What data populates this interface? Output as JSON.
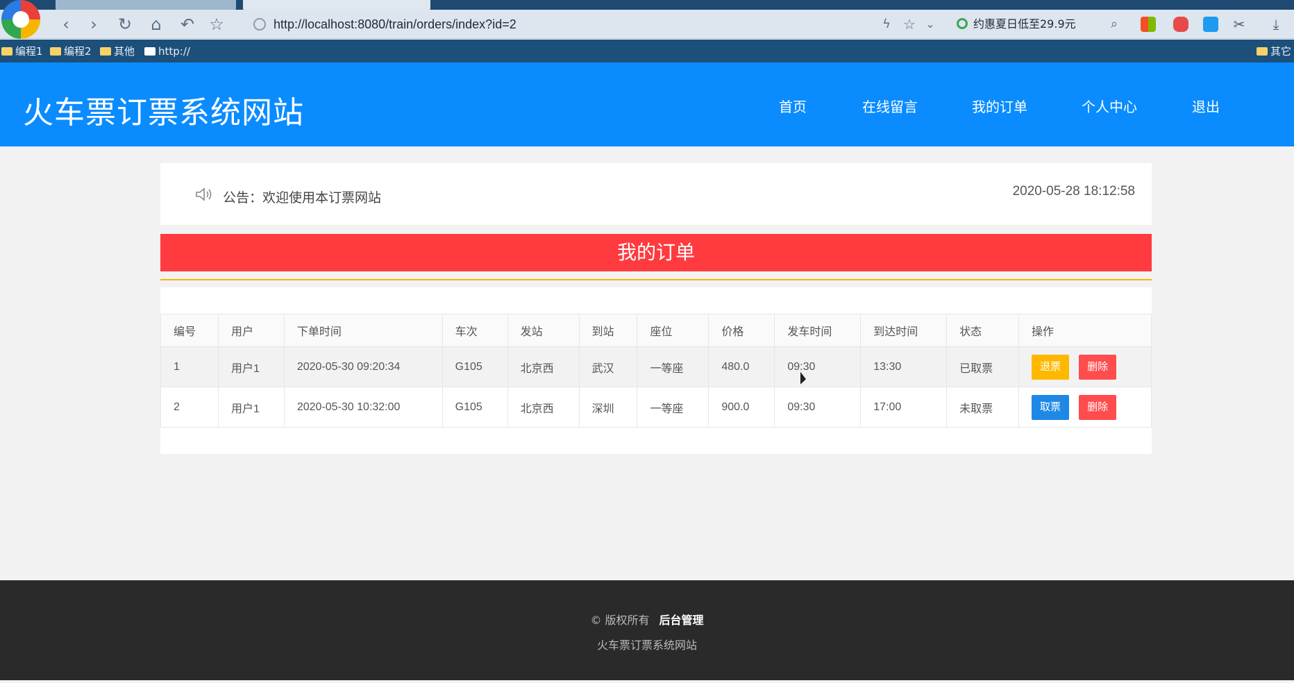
{
  "browser": {
    "url": "http://localhost:8080/train/orders/index?id=2",
    "promo": "约惠夏日低至29.9元",
    "bookmarks": [
      "编程1",
      "编程2",
      "其他",
      "http://"
    ],
    "bookmark_right": "其它"
  },
  "header": {
    "title": "火车票订票系统网站",
    "nav": [
      "首页",
      "在线留言",
      "我的订单",
      "个人中心",
      "退出"
    ]
  },
  "notice": {
    "text": "公告：欢迎使用本订票网站",
    "datetime": "2020-05-28 18:12:58"
  },
  "orders": {
    "title": "我的订单",
    "columns": [
      "编号",
      "用户",
      "下单时间",
      "车次",
      "发站",
      "到站",
      "座位",
      "价格",
      "发车时间",
      "到达时间",
      "状态",
      "操作"
    ],
    "rows": [
      {
        "id": "1",
        "user": "用户1",
        "order_time": "2020-05-30 09:20:34",
        "train": "G105",
        "from": "北京西",
        "to": "武汉",
        "seat": "一等座",
        "price": "480.0",
        "depart": "09:30",
        "arrive": "13:30",
        "status": "已取票",
        "action1": "退票",
        "action2": "删除"
      },
      {
        "id": "2",
        "user": "用户1",
        "order_time": "2020-05-30 10:32:00",
        "train": "G105",
        "from": "北京西",
        "to": "深圳",
        "seat": "一等座",
        "price": "900.0",
        "depart": "09:30",
        "arrive": "17:00",
        "status": "未取票",
        "action1": "取票",
        "action2": "删除"
      }
    ]
  },
  "footer": {
    "copyright": "© 版权所有",
    "admin_link": "后台管理",
    "site_name": "火车票订票系统网站"
  },
  "colors": {
    "header_bg": "#0a8cff",
    "banner_bg": "#ff3b3f",
    "accent_line": "#f7b500",
    "btn_warn": "#ffb800",
    "btn_danger": "#ff4c4c",
    "btn_normal": "#1e88e5"
  }
}
